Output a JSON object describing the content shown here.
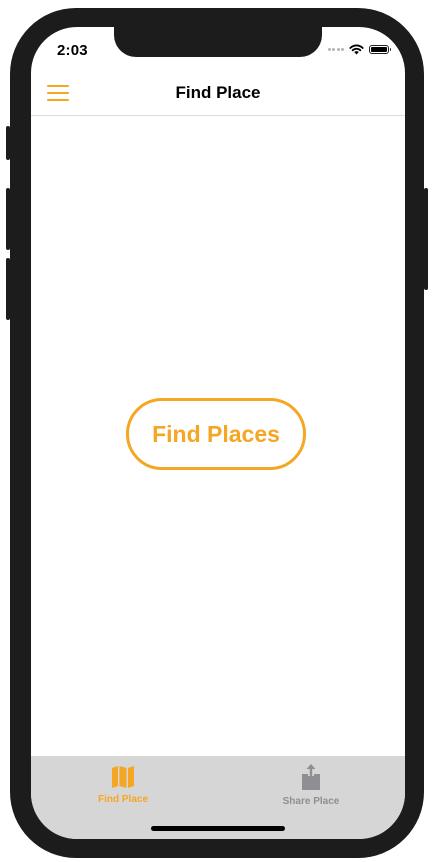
{
  "status_bar": {
    "time": "2:03"
  },
  "nav": {
    "title": "Find Place",
    "menu_icon": "hamburger-menu-icon"
  },
  "main": {
    "find_button_label": "Find Places"
  },
  "tabs": [
    {
      "label": "Find Place",
      "icon": "map-icon",
      "active": true
    },
    {
      "label": "Share Place",
      "icon": "share-icon",
      "active": false
    }
  ],
  "colors": {
    "accent": "#f5a623",
    "inactive": "#8e8e93",
    "tabbar_bg": "#d6d6d6"
  }
}
